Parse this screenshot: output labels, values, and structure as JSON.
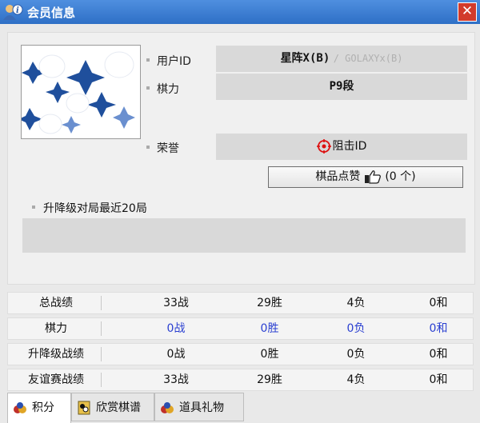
{
  "window": {
    "title": "会员信息",
    "close_label": "✕"
  },
  "profile": {
    "user_id_label": "用户ID",
    "user_id_value": "星阵X(B)",
    "user_id_alt": "/ GOLAXYx(B)",
    "strength_label": "棋力",
    "strength_value": "P9段",
    "honor_label": "荣誉",
    "honor_value": "阻击ID",
    "like_button_label": "棋品点赞",
    "like_count": "(0 个)",
    "recent_label": "升降级对局最近20局"
  },
  "stats": [
    {
      "label": "总战绩",
      "battles": "33战",
      "wins": "29胜",
      "losses": "4负",
      "draws": "0和",
      "highlight": false
    },
    {
      "label": "棋力",
      "battles": "0战",
      "wins": "0胜",
      "losses": "0负",
      "draws": "0和",
      "highlight": true
    },
    {
      "label": "升降级战绩",
      "battles": "0战",
      "wins": "0胜",
      "losses": "0负",
      "draws": "0和",
      "highlight": false
    },
    {
      "label": "友谊赛战绩",
      "battles": "33战",
      "wins": "29胜",
      "losses": "4负",
      "draws": "0和",
      "highlight": false
    }
  ],
  "tabs": [
    {
      "label": "积分",
      "active": true
    },
    {
      "label": "欣赏棋谱",
      "active": false
    },
    {
      "label": "道具礼物",
      "active": false
    }
  ],
  "colors": {
    "titlebar": "#2e6fc6",
    "close": "#d23b2b",
    "blue_text": "#2a3fd1"
  }
}
